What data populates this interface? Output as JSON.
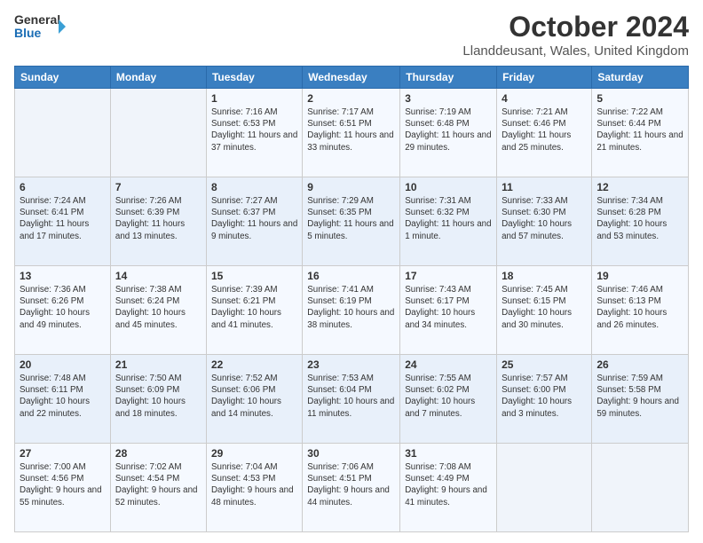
{
  "header": {
    "logo_general": "General",
    "logo_blue": "Blue",
    "title": "October 2024",
    "location": "Llanddeusant, Wales, United Kingdom"
  },
  "days_of_week": [
    "Sunday",
    "Monday",
    "Tuesday",
    "Wednesday",
    "Thursday",
    "Friday",
    "Saturday"
  ],
  "weeks": [
    [
      {
        "day": "",
        "info": ""
      },
      {
        "day": "",
        "info": ""
      },
      {
        "day": "1",
        "info": "Sunrise: 7:16 AM\nSunset: 6:53 PM\nDaylight: 11 hours and 37 minutes."
      },
      {
        "day": "2",
        "info": "Sunrise: 7:17 AM\nSunset: 6:51 PM\nDaylight: 11 hours and 33 minutes."
      },
      {
        "day": "3",
        "info": "Sunrise: 7:19 AM\nSunset: 6:48 PM\nDaylight: 11 hours and 29 minutes."
      },
      {
        "day": "4",
        "info": "Sunrise: 7:21 AM\nSunset: 6:46 PM\nDaylight: 11 hours and 25 minutes."
      },
      {
        "day": "5",
        "info": "Sunrise: 7:22 AM\nSunset: 6:44 PM\nDaylight: 11 hours and 21 minutes."
      }
    ],
    [
      {
        "day": "6",
        "info": "Sunrise: 7:24 AM\nSunset: 6:41 PM\nDaylight: 11 hours and 17 minutes."
      },
      {
        "day": "7",
        "info": "Sunrise: 7:26 AM\nSunset: 6:39 PM\nDaylight: 11 hours and 13 minutes."
      },
      {
        "day": "8",
        "info": "Sunrise: 7:27 AM\nSunset: 6:37 PM\nDaylight: 11 hours and 9 minutes."
      },
      {
        "day": "9",
        "info": "Sunrise: 7:29 AM\nSunset: 6:35 PM\nDaylight: 11 hours and 5 minutes."
      },
      {
        "day": "10",
        "info": "Sunrise: 7:31 AM\nSunset: 6:32 PM\nDaylight: 11 hours and 1 minute."
      },
      {
        "day": "11",
        "info": "Sunrise: 7:33 AM\nSunset: 6:30 PM\nDaylight: 10 hours and 57 minutes."
      },
      {
        "day": "12",
        "info": "Sunrise: 7:34 AM\nSunset: 6:28 PM\nDaylight: 10 hours and 53 minutes."
      }
    ],
    [
      {
        "day": "13",
        "info": "Sunrise: 7:36 AM\nSunset: 6:26 PM\nDaylight: 10 hours and 49 minutes."
      },
      {
        "day": "14",
        "info": "Sunrise: 7:38 AM\nSunset: 6:24 PM\nDaylight: 10 hours and 45 minutes."
      },
      {
        "day": "15",
        "info": "Sunrise: 7:39 AM\nSunset: 6:21 PM\nDaylight: 10 hours and 41 minutes."
      },
      {
        "day": "16",
        "info": "Sunrise: 7:41 AM\nSunset: 6:19 PM\nDaylight: 10 hours and 38 minutes."
      },
      {
        "day": "17",
        "info": "Sunrise: 7:43 AM\nSunset: 6:17 PM\nDaylight: 10 hours and 34 minutes."
      },
      {
        "day": "18",
        "info": "Sunrise: 7:45 AM\nSunset: 6:15 PM\nDaylight: 10 hours and 30 minutes."
      },
      {
        "day": "19",
        "info": "Sunrise: 7:46 AM\nSunset: 6:13 PM\nDaylight: 10 hours and 26 minutes."
      }
    ],
    [
      {
        "day": "20",
        "info": "Sunrise: 7:48 AM\nSunset: 6:11 PM\nDaylight: 10 hours and 22 minutes."
      },
      {
        "day": "21",
        "info": "Sunrise: 7:50 AM\nSunset: 6:09 PM\nDaylight: 10 hours and 18 minutes."
      },
      {
        "day": "22",
        "info": "Sunrise: 7:52 AM\nSunset: 6:06 PM\nDaylight: 10 hours and 14 minutes."
      },
      {
        "day": "23",
        "info": "Sunrise: 7:53 AM\nSunset: 6:04 PM\nDaylight: 10 hours and 11 minutes."
      },
      {
        "day": "24",
        "info": "Sunrise: 7:55 AM\nSunset: 6:02 PM\nDaylight: 10 hours and 7 minutes."
      },
      {
        "day": "25",
        "info": "Sunrise: 7:57 AM\nSunset: 6:00 PM\nDaylight: 10 hours and 3 minutes."
      },
      {
        "day": "26",
        "info": "Sunrise: 7:59 AM\nSunset: 5:58 PM\nDaylight: 9 hours and 59 minutes."
      }
    ],
    [
      {
        "day": "27",
        "info": "Sunrise: 7:00 AM\nSunset: 4:56 PM\nDaylight: 9 hours and 55 minutes."
      },
      {
        "day": "28",
        "info": "Sunrise: 7:02 AM\nSunset: 4:54 PM\nDaylight: 9 hours and 52 minutes."
      },
      {
        "day": "29",
        "info": "Sunrise: 7:04 AM\nSunset: 4:53 PM\nDaylight: 9 hours and 48 minutes."
      },
      {
        "day": "30",
        "info": "Sunrise: 7:06 AM\nSunset: 4:51 PM\nDaylight: 9 hours and 44 minutes."
      },
      {
        "day": "31",
        "info": "Sunrise: 7:08 AM\nSunset: 4:49 PM\nDaylight: 9 hours and 41 minutes."
      },
      {
        "day": "",
        "info": ""
      },
      {
        "day": "",
        "info": ""
      }
    ]
  ]
}
